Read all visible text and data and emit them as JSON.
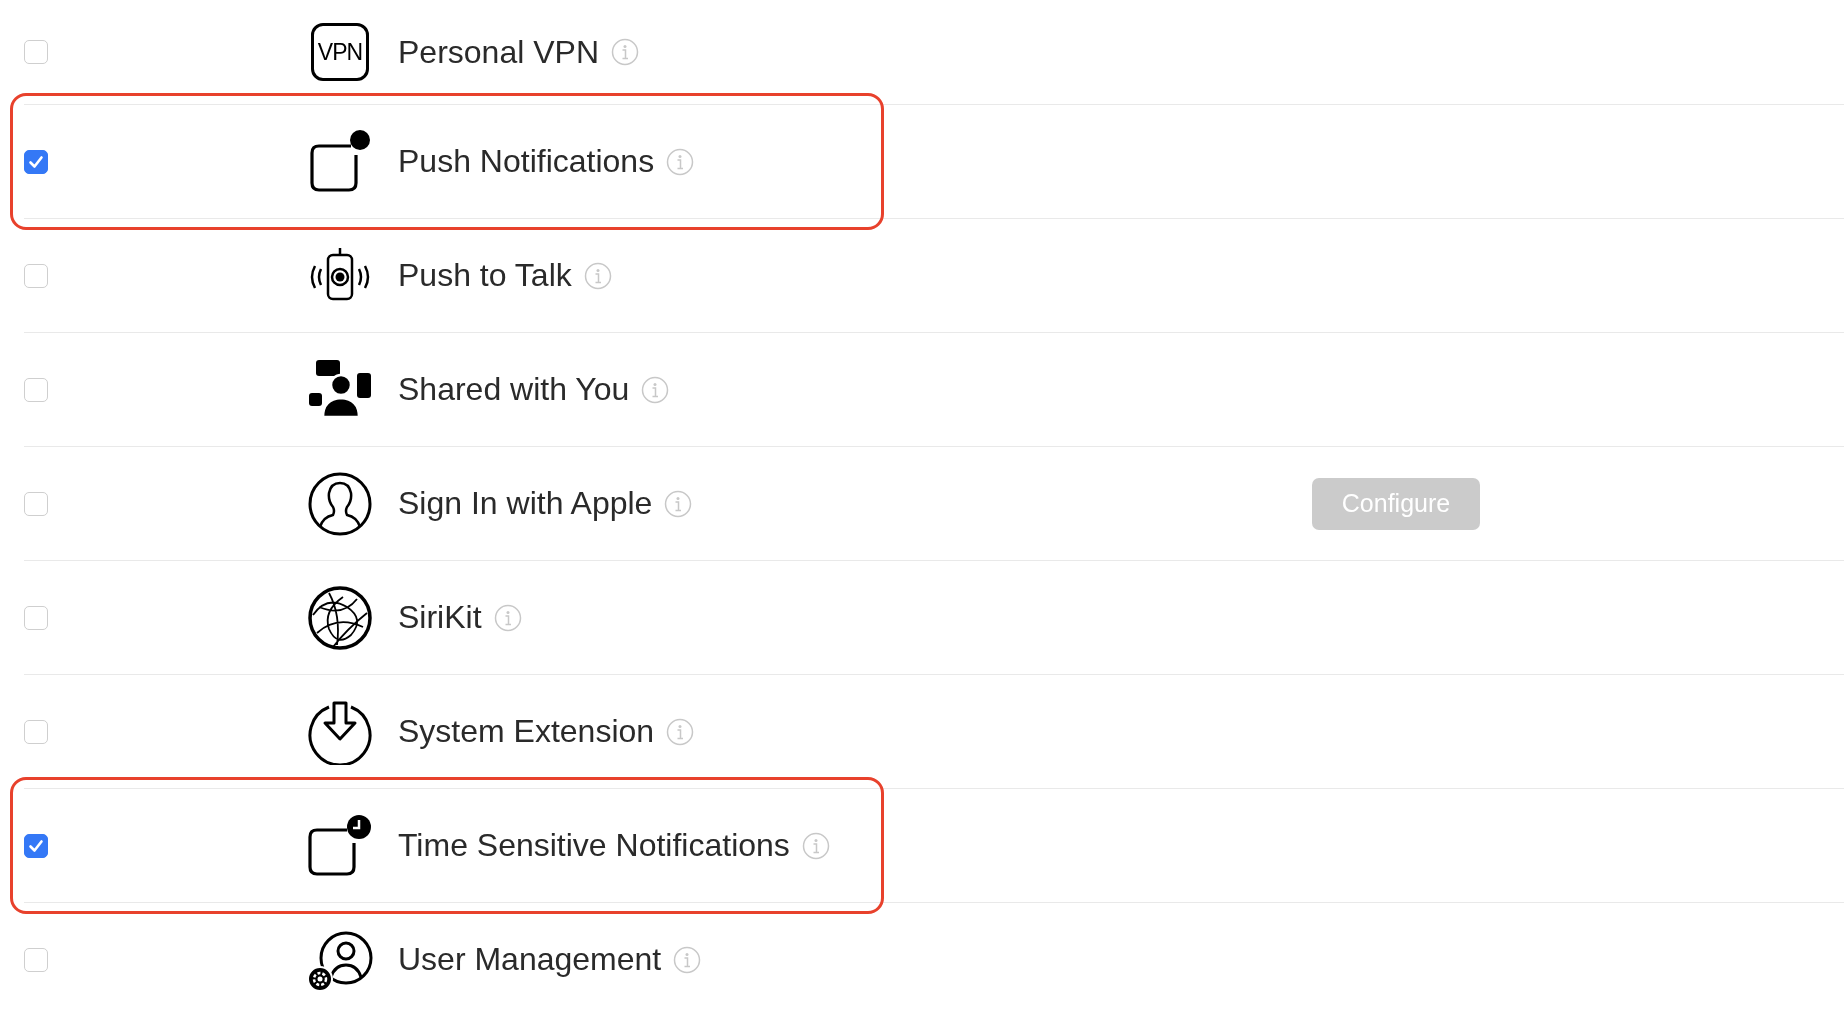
{
  "capabilities": [
    {
      "icon_text": "VPN",
      "label": "Personal VPN",
      "checked": false,
      "highlighted": false
    },
    {
      "label": "Push Notifications",
      "checked": true,
      "highlighted": true
    },
    {
      "label": "Push to Talk",
      "checked": false,
      "highlighted": false
    },
    {
      "label": "Shared with You",
      "checked": false,
      "highlighted": false
    },
    {
      "label": "Sign In with Apple",
      "checked": false,
      "highlighted": false,
      "action": {
        "label": "Configure",
        "disabled": true
      }
    },
    {
      "label": "SiriKit",
      "checked": false,
      "highlighted": false
    },
    {
      "label": "System Extension",
      "checked": false,
      "highlighted": false
    },
    {
      "label": "Time Sensitive Notifications",
      "checked": true,
      "highlighted": true
    },
    {
      "label": "User Management",
      "checked": false,
      "highlighted": false
    }
  ]
}
